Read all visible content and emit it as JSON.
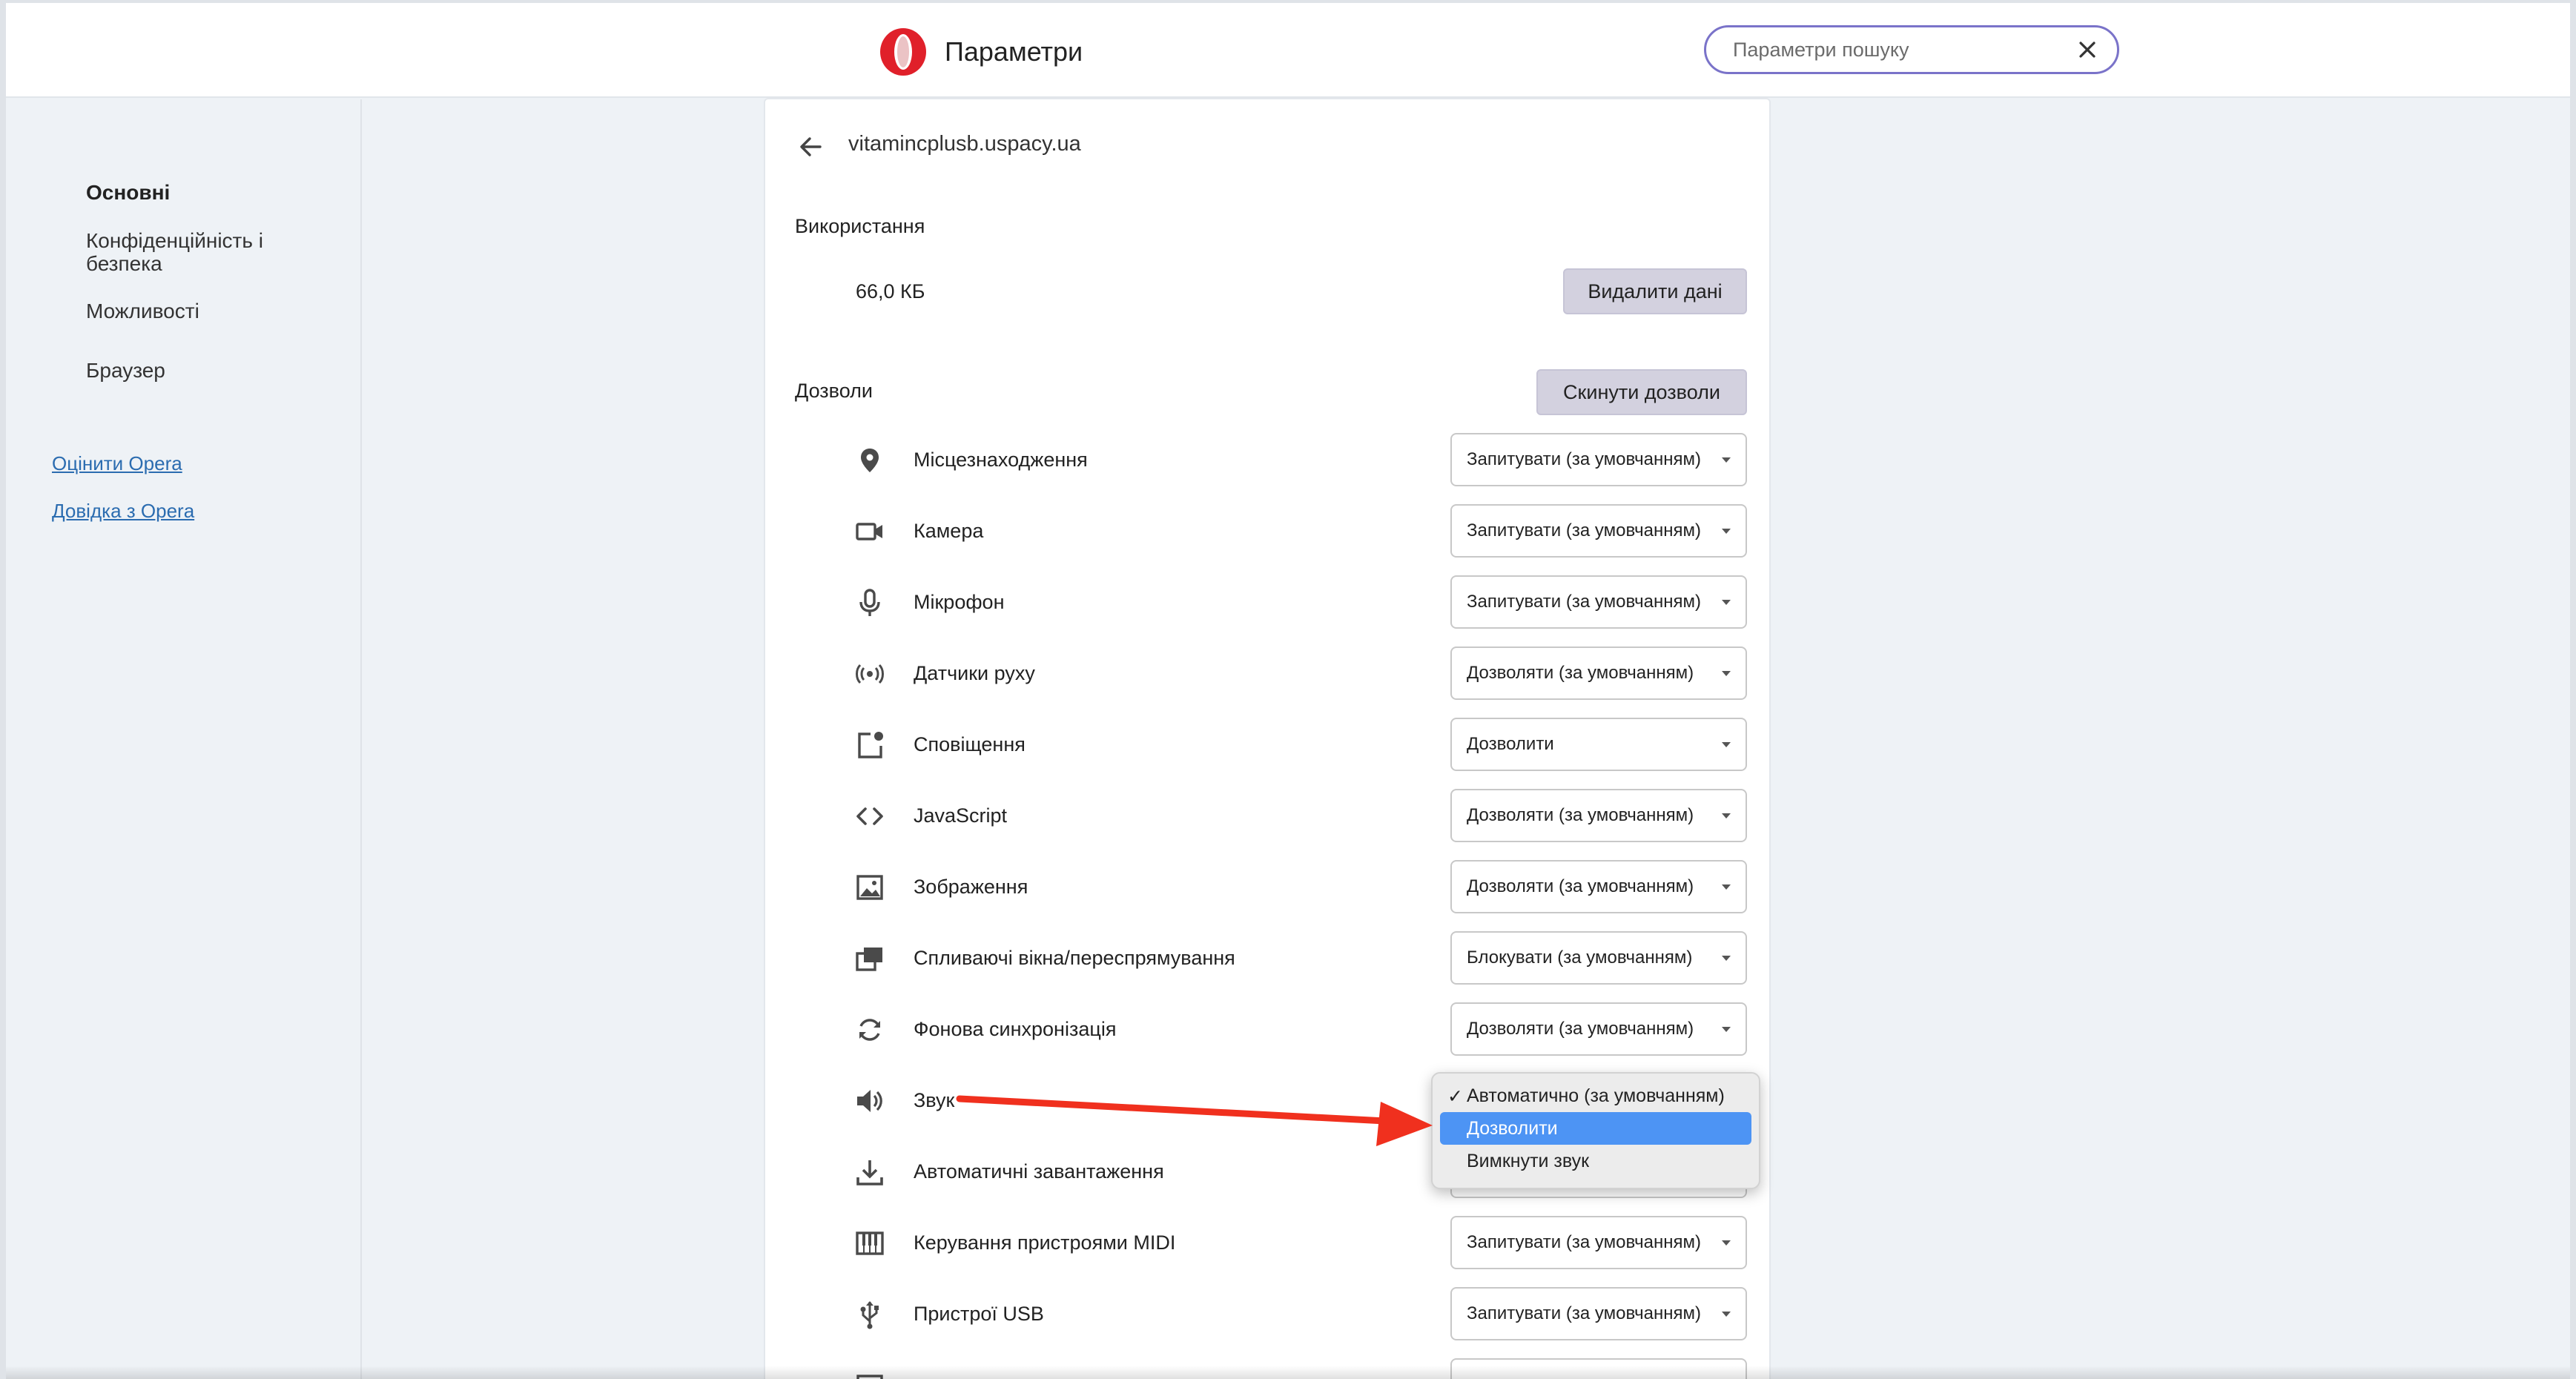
{
  "header": {
    "title": "Параметри",
    "search_placeholder": "Параметри пошуку"
  },
  "sidebar": {
    "items": [
      {
        "label": "Основні"
      },
      {
        "label": "Конфіденційність і безпека"
      },
      {
        "label": "Можливості"
      },
      {
        "label": "Браузер"
      }
    ],
    "links": [
      {
        "label": "Оцінити Opera"
      },
      {
        "label": "Довідка з Opera"
      }
    ]
  },
  "site": {
    "name": "vitamincplusb.uspacy.ua",
    "usage_title": "Використання",
    "usage_value": "66,0 КБ",
    "delete_button": "Видалити дані",
    "permissions_title": "Дозволи",
    "reset_button": "Скинути дозволи"
  },
  "permissions": [
    {
      "label": "Місцезнаходження",
      "value": "Запитувати (за умовчанням)",
      "icon": "location-icon"
    },
    {
      "label": "Камера",
      "value": "Запитувати (за умовчанням)",
      "icon": "camera-icon"
    },
    {
      "label": "Мікрофон",
      "value": "Запитувати (за умовчанням)",
      "icon": "microphone-icon"
    },
    {
      "label": "Датчики руху",
      "value": "Дозволяти (за умовчанням)",
      "icon": "motion-sensors-icon"
    },
    {
      "label": "Сповіщення",
      "value": "Дозволити",
      "icon": "notifications-icon"
    },
    {
      "label": "JavaScript",
      "value": "Дозволяти (за умовчанням)",
      "icon": "code-icon"
    },
    {
      "label": "Зображення",
      "value": "Дозволяти (за умовчанням)",
      "icon": "image-icon"
    },
    {
      "label": "Спливаючі вікна/переспрямування",
      "value": "Блокувати (за умовчанням)",
      "icon": "popup-icon"
    },
    {
      "label": "Фонова синхронізація",
      "value": "Дозволяти (за умовчанням)",
      "icon": "sync-icon"
    },
    {
      "label": "Звук",
      "value": "",
      "icon": "sound-icon"
    },
    {
      "label": "Автоматичні завантаження",
      "value": "",
      "icon": "download-icon"
    },
    {
      "label": "Керування пристроями MIDI",
      "value": "Запитувати (за умовчанням)",
      "icon": "midi-icon"
    },
    {
      "label": "Пристрої USB",
      "value": "Запитувати (за умовчанням)",
      "icon": "usb-icon"
    }
  ],
  "sound_dropdown": {
    "options": [
      {
        "label": "Автоматично (за умовчанням)",
        "checked": true
      },
      {
        "label": "Дозволити",
        "highlighted": true
      },
      {
        "label": "Вимкнути звук"
      }
    ]
  },
  "colors": {
    "accent": "#7a73c9",
    "link": "#2b6cb0",
    "highlight": "#4d94f4",
    "annotation_arrow": "#f0301e",
    "opera_red": "#e0202a"
  }
}
